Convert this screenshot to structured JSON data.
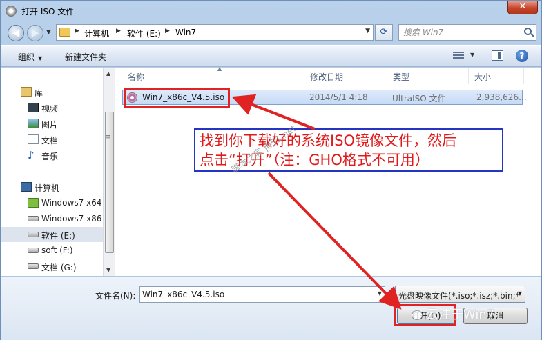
{
  "window": {
    "title": "打开 ISO 文件",
    "close_label": "✕"
  },
  "address": {
    "crumbs": [
      "计算机",
      "软件 (E:)",
      "Win7"
    ],
    "search_placeholder": "搜索 Win7"
  },
  "toolbar": {
    "organize_label": "组织",
    "new_folder_label": "新建文件夹",
    "help_label": "?"
  },
  "nav": {
    "items": [
      {
        "label": "库",
        "icon": "library-icon"
      },
      {
        "label": "视频",
        "icon": "video-icon"
      },
      {
        "label": "图片",
        "icon": "pictures-icon"
      },
      {
        "label": "文档",
        "icon": "documents-icon"
      },
      {
        "label": "音乐",
        "icon": "music-icon"
      },
      {
        "label": "计算机",
        "icon": "computer-icon"
      },
      {
        "label": "Windows7 x64",
        "icon": "os-drive-icon"
      },
      {
        "label": "Windows7 x86",
        "icon": "drive-icon"
      },
      {
        "label": "软件 (E:)",
        "icon": "drive-icon",
        "selected": true
      },
      {
        "label": "soft (F:)",
        "icon": "drive-icon"
      },
      {
        "label": "文档 (G:)",
        "icon": "drive-icon"
      }
    ]
  },
  "columns": {
    "name": "名称",
    "modified": "修改日期",
    "type": "类型",
    "size": "大小"
  },
  "files": [
    {
      "name": "Win7_x86c_V4.5.iso",
      "modified": "2014/5/1 4:18",
      "type": "UltraISO 文件",
      "size": "2,938,626..."
    }
  ],
  "annotation": {
    "line1": "找到你下载好的系统ISO镜像文件，然后",
    "line2": "点击“打开”（注：GHO格式不可用）",
    "watermark": "脚本之家 jb51.net",
    "color": "#e01a1a"
  },
  "bottom": {
    "filename_label": "文件名(N):",
    "filename_value": "Win7_x86c_V4.5.iso",
    "filetype_value": "光盘映像文件(*.iso;*.isz;*.bin;*",
    "open_label": "打开(O)",
    "cancel_label": "取消",
    "wechat_mark": "云注于Win7"
  },
  "colors": {
    "highlight_red": "#e02222",
    "annotation_border": "#2534c2",
    "selection": "#c6daf6"
  }
}
